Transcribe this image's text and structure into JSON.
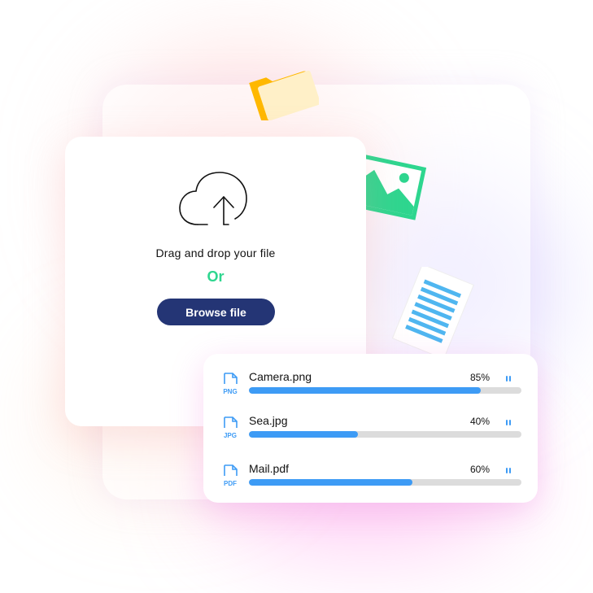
{
  "upload": {
    "drag_text": "Drag and drop your file",
    "or_text": "Or",
    "browse_label": "Browse file",
    "cloud_icon": "cloud-upload-icon"
  },
  "decorations": {
    "folder_icon": "folder-icon",
    "image_icon": "image-icon",
    "document_icon": "document-icon"
  },
  "uploads": [
    {
      "name": "Camera.png",
      "type": "PNG",
      "percent_label": "85%",
      "progress": 0.85
    },
    {
      "name": "Sea.jpg",
      "type": "JPG",
      "percent_label": "40%",
      "progress": 0.4
    },
    {
      "name": "Mail.pdf",
      "type": "PDF",
      "percent_label": "60%",
      "progress": 0.6
    }
  ],
  "colors": {
    "accent_green": "#2ed68f",
    "button_navy": "#243575",
    "progress_blue": "#3d9bf5",
    "track_gray": "#dcdcdc",
    "folder_yellow": "#ffb800",
    "doc_lines_blue": "#4fb6f0"
  }
}
